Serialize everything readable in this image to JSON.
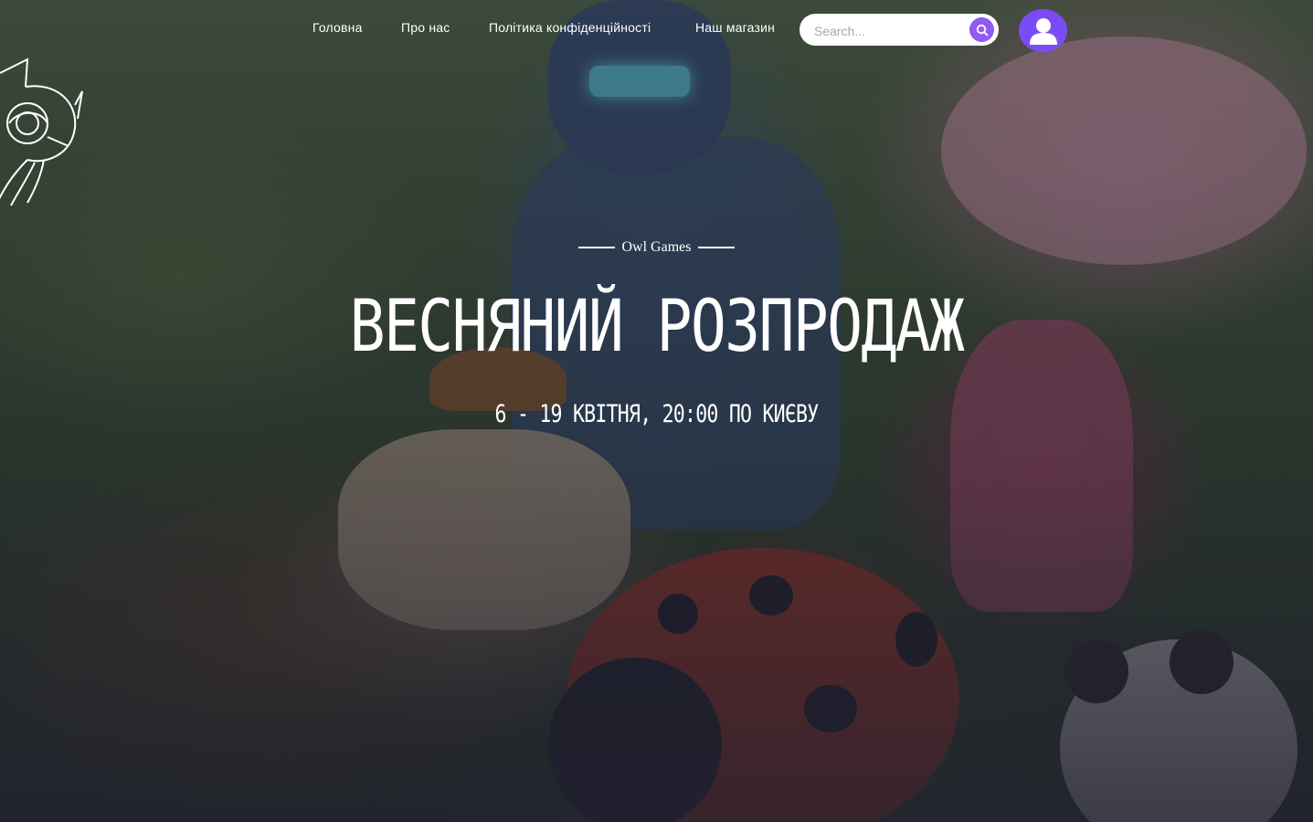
{
  "nav": {
    "links": [
      "Головна",
      "Про нас",
      "Політика конфіденційності",
      "Наш магазин"
    ]
  },
  "search": {
    "placeholder": "Search..."
  },
  "hero": {
    "kicker": "Owl Games",
    "title": "ВЕСНЯНИЙ РОЗПРОДАЖ",
    "subtitle": "6 - 19 КВІТНЯ, 20:00 ПО КИЄВУ"
  },
  "icons": {
    "logo": "owl-logo-icon",
    "search": "search-icon",
    "user": "user-icon"
  },
  "colors": {
    "accent": "#8f5bf2",
    "avatar_bg": "#7b4cf5",
    "text": "#ffffff"
  }
}
